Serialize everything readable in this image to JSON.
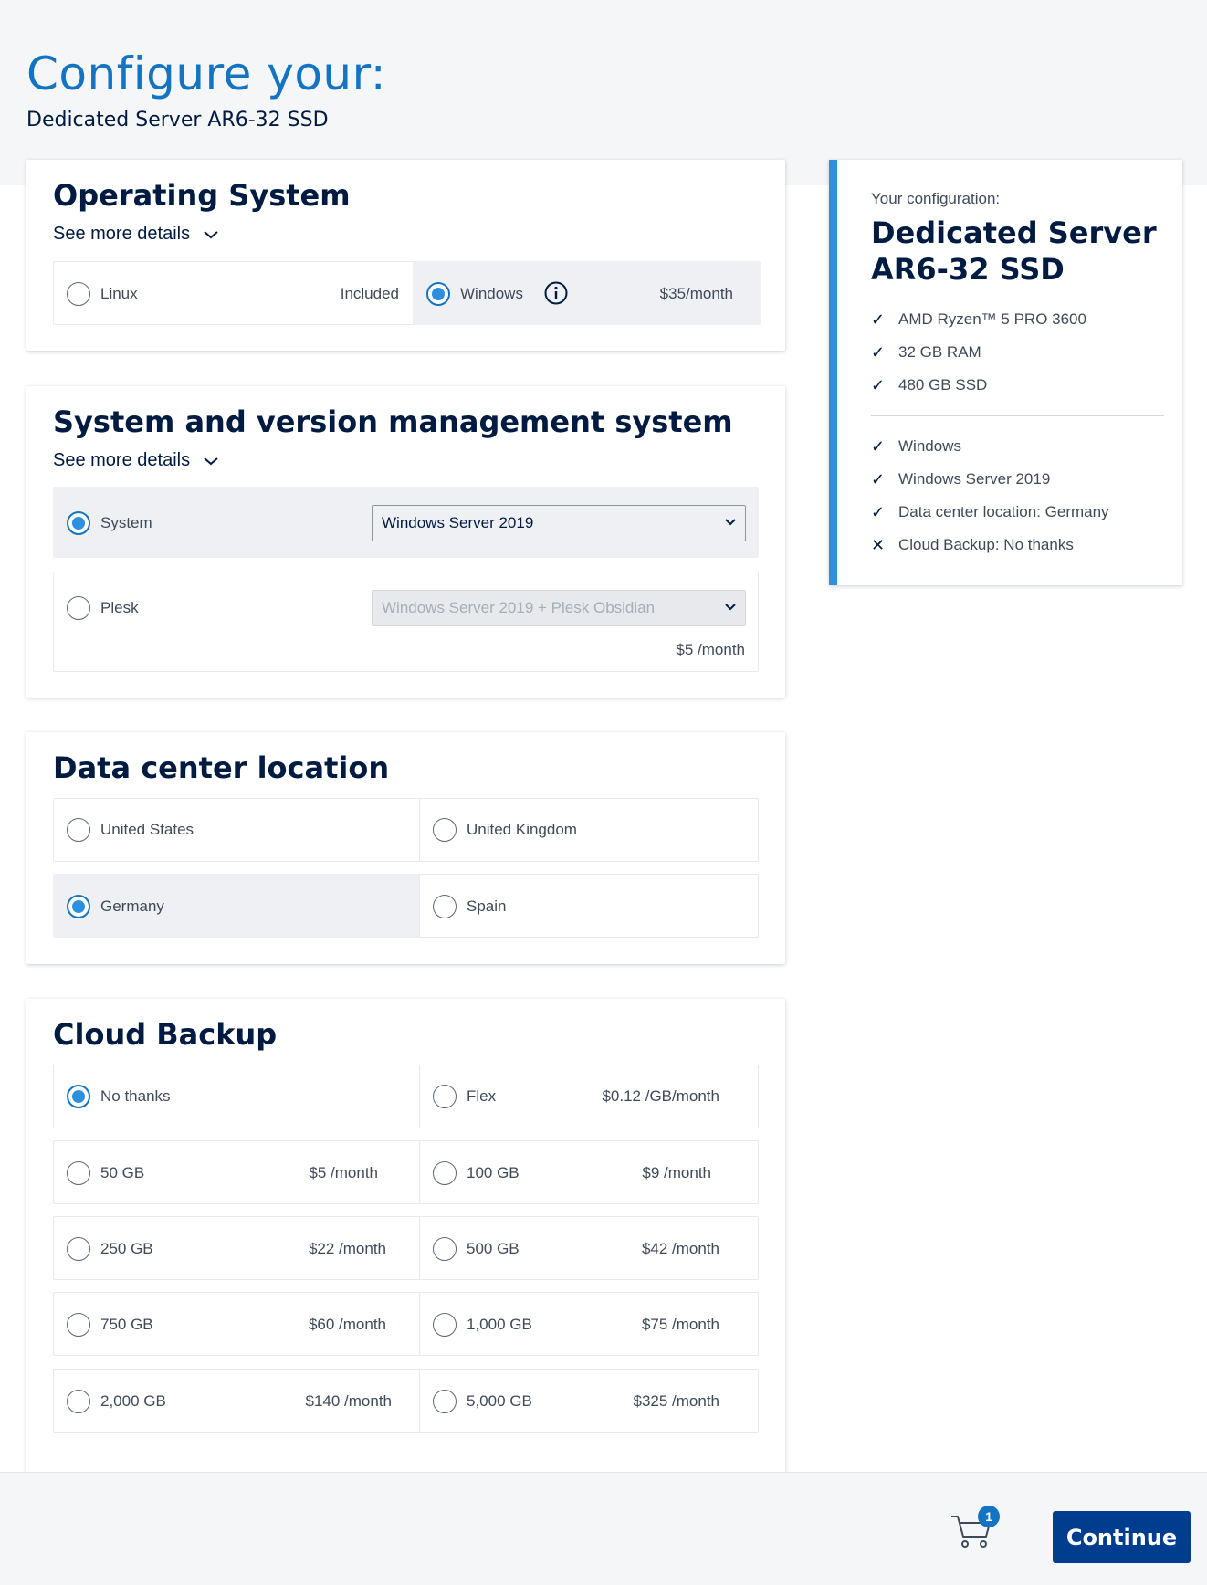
{
  "header": {
    "title": "Configure your:",
    "subtitle": "Dedicated Server AR6-32 SSD"
  },
  "os": {
    "title": "Operating System",
    "details": "See more details",
    "options": [
      {
        "label": "Linux",
        "price": "Included",
        "selected": false
      },
      {
        "label": "Windows",
        "price": "$35/month",
        "selected": true
      }
    ]
  },
  "svm": {
    "title": "System and version management system",
    "details": "See more details",
    "options": [
      {
        "label": "System",
        "select_value": "Windows Server 2019",
        "selected": true
      },
      {
        "label": "Plesk",
        "select_value": "Windows Server 2019 + Plesk Obsidian",
        "price": "$5 /month",
        "selected": false
      }
    ]
  },
  "datacenter": {
    "title": "Data center location",
    "options": [
      {
        "label": "United States",
        "selected": false
      },
      {
        "label": "United Kingdom",
        "selected": false
      },
      {
        "label": "Germany",
        "selected": true
      },
      {
        "label": "Spain",
        "selected": false
      }
    ]
  },
  "backup": {
    "title": "Cloud Backup",
    "options": [
      {
        "label": "No thanks",
        "price": "",
        "selected": true
      },
      {
        "label": "Flex",
        "price": "$0.12 /GB/month",
        "selected": false
      },
      {
        "label": "50 GB",
        "price": "$5 /month",
        "selected": false
      },
      {
        "label": "100 GB",
        "price": "$9 /month",
        "selected": false
      },
      {
        "label": "250 GB",
        "price": "$22 /month",
        "selected": false
      },
      {
        "label": "500 GB",
        "price": "$42 /month",
        "selected": false
      },
      {
        "label": "750 GB",
        "price": "$60 /month",
        "selected": false
      },
      {
        "label": "1,000 GB",
        "price": "$75 /month",
        "selected": false
      },
      {
        "label": "2,000 GB",
        "price": "$140 /month",
        "selected": false
      },
      {
        "label": "5,000 GB",
        "price": "$325 /month",
        "selected": false
      }
    ]
  },
  "summary": {
    "caption": "Your configuration:",
    "title": "Dedicated Server AR6-32 SSD",
    "specs": [
      "AMD Ryzen™ 5 PRO 3600",
      "32 GB RAM",
      "480 GB SSD"
    ],
    "choices": [
      {
        "text": "Windows",
        "mark": "✓"
      },
      {
        "text": "Windows Server 2019",
        "mark": "✓"
      },
      {
        "text": "Data center location: Germany",
        "mark": "✓"
      },
      {
        "text": "Cloud Backup: No thanks",
        "mark": "✕"
      }
    ]
  },
  "footer": {
    "cart_count": "1",
    "continue_label": "Continue"
  },
  "colors": {
    "accent": "#1474c4",
    "radio_fill": "#2c8fe0",
    "navy": "#001b41",
    "button": "#003d8f"
  }
}
